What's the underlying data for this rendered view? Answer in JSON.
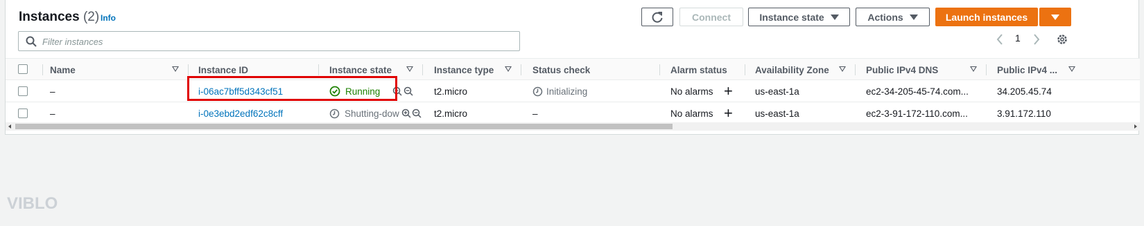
{
  "header": {
    "title": "Instances",
    "count": "(2)",
    "info": "Info"
  },
  "toolbar": {
    "refresh_icon": "refresh-icon",
    "connect": "Connect",
    "instance_state": "Instance state",
    "actions": "Actions",
    "launch": "Launch instances"
  },
  "search": {
    "placeholder": "Filter instances"
  },
  "pagination": {
    "page": "1"
  },
  "columns": [
    "Name",
    "Instance ID",
    "Instance state",
    "Instance type",
    "Status check",
    "Alarm status",
    "Availability Zone",
    "Public IPv4 DNS",
    "Public IPv4 ..."
  ],
  "rows": [
    {
      "name": "–",
      "id": "i-06ac7bff5d343cf51",
      "state": "Running",
      "state_icon": "check-circle-icon",
      "type": "t2.micro",
      "status_check": "Initializing",
      "alarm": "No alarms",
      "zone": "us-east-1a",
      "dns": "ec2-34-205-45-74.com...",
      "ip": "34.205.45.74"
    },
    {
      "name": "–",
      "id": "i-0e3ebd2edf62c8cff",
      "state": "Shutting-dow",
      "state_icon": "clock-icon",
      "type": "t2.micro",
      "status_check": "–",
      "alarm": "No alarms",
      "zone": "us-east-1a",
      "dns": "ec2-3-91-172-110.com...",
      "ip": "3.91.172.110"
    }
  ],
  "watermark": "VIBLO",
  "colors": {
    "primary": "#ec7211",
    "link": "#0073bb",
    "running": "#1d8102",
    "highlight": "#e00000"
  }
}
